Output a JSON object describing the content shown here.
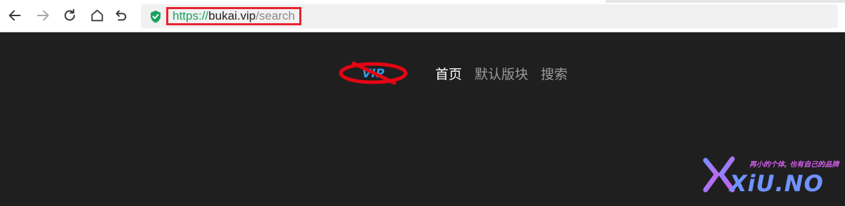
{
  "browser": {
    "icons": {
      "back": "back-arrow-icon",
      "forward": "forward-arrow-icon",
      "reload": "reload-icon",
      "home": "home-icon",
      "undo": "undo-icon",
      "security": "security-shield-icon"
    },
    "url": {
      "scheme": "https://",
      "host": "bukai.vip",
      "path": "/search"
    },
    "colors": {
      "secure": "#1aa260",
      "highlight_border": "#e8232f"
    }
  },
  "site": {
    "logo_text": "VIP",
    "nav": [
      {
        "label": "首页",
        "active": true
      },
      {
        "label": "默认版块",
        "active": false
      },
      {
        "label": "搜索",
        "active": false
      }
    ],
    "colors": {
      "background": "#1f1f1f",
      "nav_active": "#ffffff",
      "nav_inactive": "#9b9b9b"
    }
  },
  "watermark": {
    "slogan": "再小的个体, 也有自己的品牌",
    "brand": "XiU.NO"
  }
}
